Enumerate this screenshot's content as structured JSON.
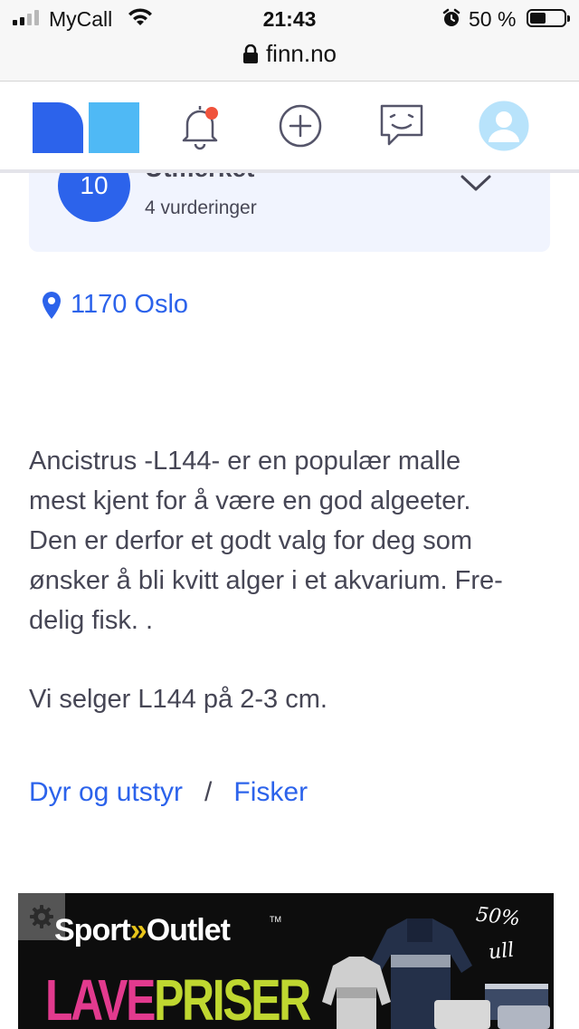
{
  "status_bar": {
    "carrier": "MyCall",
    "time": "21:43",
    "battery_percent": "50 %",
    "battery_level": 0.5
  },
  "browser": {
    "url": "finn.no"
  },
  "header": {
    "icons": [
      "finn-logo",
      "notification-bell-icon",
      "add-icon",
      "messages-icon",
      "profile-icon"
    ],
    "notification_dot_color": "#f0533c"
  },
  "seller": {
    "badge_value": "10",
    "name": "Utmerket",
    "ratings": "4 vurderinger"
  },
  "location": {
    "text": "1170 Oslo"
  },
  "description": {
    "lines": [
      "Ancistrus -L144- er en populær malle",
      "mest kjent for å være en god algeeter.",
      "Den er derfor et godt valg for deg som",
      "ønsker å bli kvitt alger i et akvarium. Fre-",
      "delig fisk. ."
    ],
    "second_paragraph": "Vi selger L144 på 2-3 cm."
  },
  "breadcrumb": {
    "items": [
      "Dyr og utstyr",
      "Fisker"
    ],
    "separator": "/"
  },
  "ad": {
    "brand_part1": "Sport",
    "brand_arrows": "»",
    "brand_part2": "Outlet",
    "trademark": "TM",
    "headline_part1": "LAVE",
    "headline_part2": "PRISER",
    "promo_percent": "50%",
    "promo_material": "ull"
  },
  "colors": {
    "link": "#2c63eb",
    "text": "#464655",
    "card_bg": "#f1f4fe",
    "logo_dark": "#2c63eb",
    "logo_light": "#4fb9f5"
  }
}
